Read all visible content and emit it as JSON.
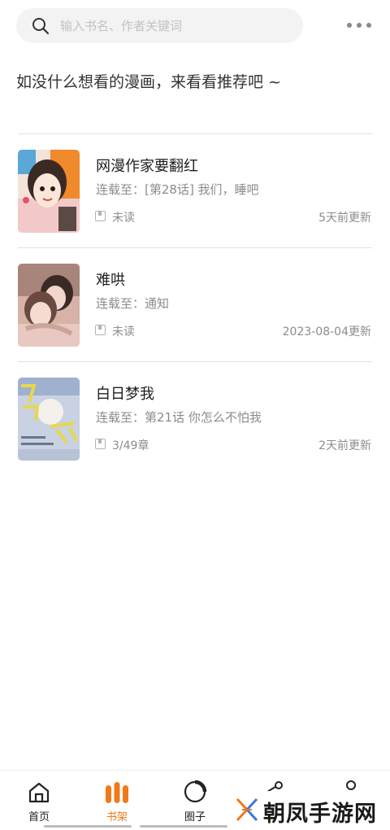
{
  "search": {
    "placeholder": "输入书名、作者关键词",
    "value": ""
  },
  "recommend_tip": "如没什么想看的漫画，来看看推荐吧 ~",
  "books": [
    {
      "title": "网漫作家要翻红",
      "latest": "连载至：[第28话] 我们，睡吧",
      "read_status": "未读",
      "update_time": "5天前更新"
    },
    {
      "title": "难哄",
      "latest": "连载至：通知",
      "read_status": "未读",
      "update_time": "2023-08-04更新"
    },
    {
      "title": "白日梦我",
      "latest": "连载至：第21话 你怎么不怕我",
      "read_status": "3/49章",
      "update_time": "2天前更新"
    }
  ],
  "tabs": [
    {
      "label": "首页",
      "icon": "home-icon",
      "active": false
    },
    {
      "label": "书架",
      "icon": "bookshelf-icon",
      "active": true
    },
    {
      "label": "圈子",
      "icon": "circle-icon",
      "active": false
    }
  ],
  "watermark": "朝凤手游网",
  "colors": {
    "accent": "#f07a1a",
    "text_primary": "#1d1d1d",
    "text_secondary": "#8c8c8c",
    "search_bg": "#f3f3f3"
  }
}
